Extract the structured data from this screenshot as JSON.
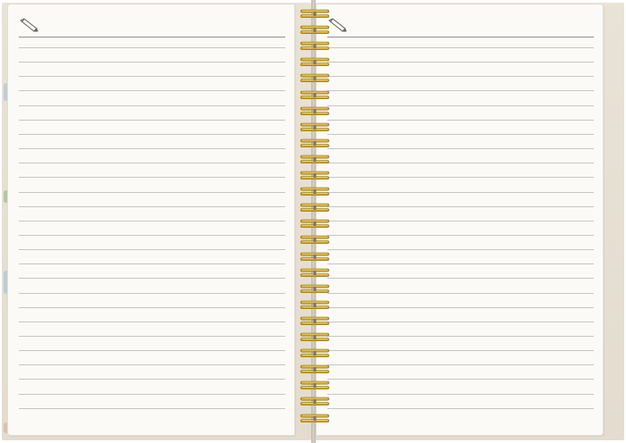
{
  "notebook": {
    "type": "spiral notebook open spread",
    "left_page": {
      "icon": "pencil-icon",
      "ruled_lines": 26
    },
    "right_page": {
      "icon": "pencil-icon",
      "ruled_lines": 26
    },
    "binding": {
      "style": "double wire spiral",
      "ring_count": 26,
      "ring_color": "#c9a227"
    },
    "colors": {
      "page": "#fbfaf7",
      "cover": "#e6dfd3",
      "rule": "#c6c6c6",
      "header_rule": "#8f8f8f"
    }
  }
}
